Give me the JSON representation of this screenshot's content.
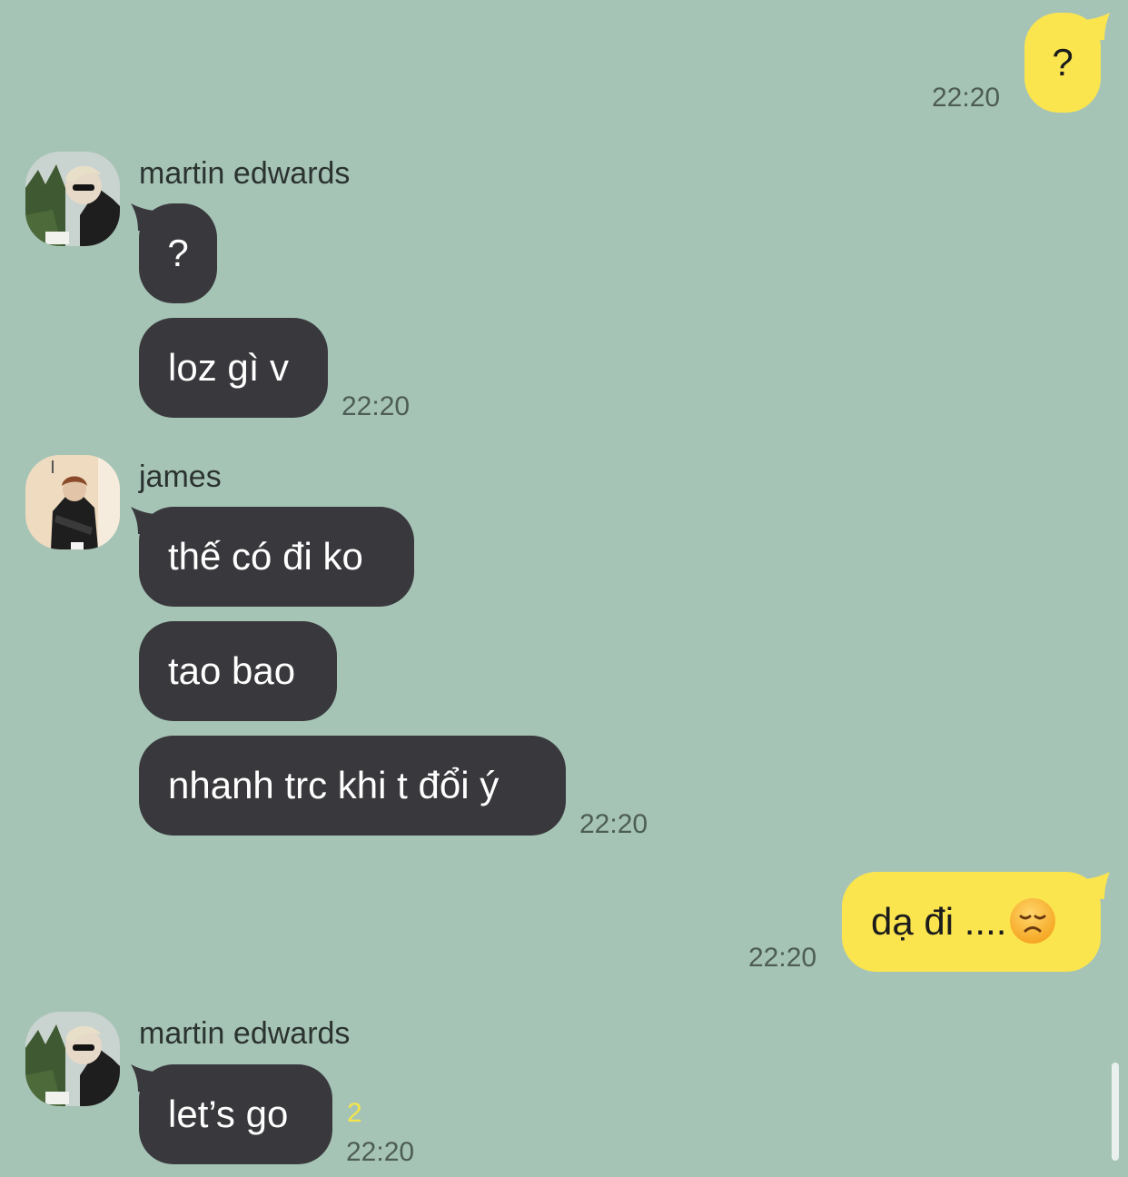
{
  "messages": {
    "m1": {
      "text": "?",
      "time": "22:20"
    },
    "g1": {
      "sender": "martin edwards",
      "lines": [
        "?",
        "loz gì v"
      ],
      "time": "22:20"
    },
    "g2": {
      "sender": "james",
      "lines": [
        "thế có đi ko",
        "tao bao",
        "nhanh trc khi t đổi ý"
      ],
      "time": "22:20"
    },
    "m2": {
      "text": "dạ đi ....",
      "emoji": "disappointed-face-emoji",
      "time": "22:20"
    },
    "g3": {
      "sender": "martin edwards",
      "lines": [
        "let’s go"
      ],
      "unread": "2",
      "time": "22:20"
    }
  },
  "colors": {
    "background": "#a6c4b6",
    "incoming_bubble": "#39393d",
    "outgoing_bubble": "#fbe54f",
    "unread_count": "#f3e44a"
  }
}
